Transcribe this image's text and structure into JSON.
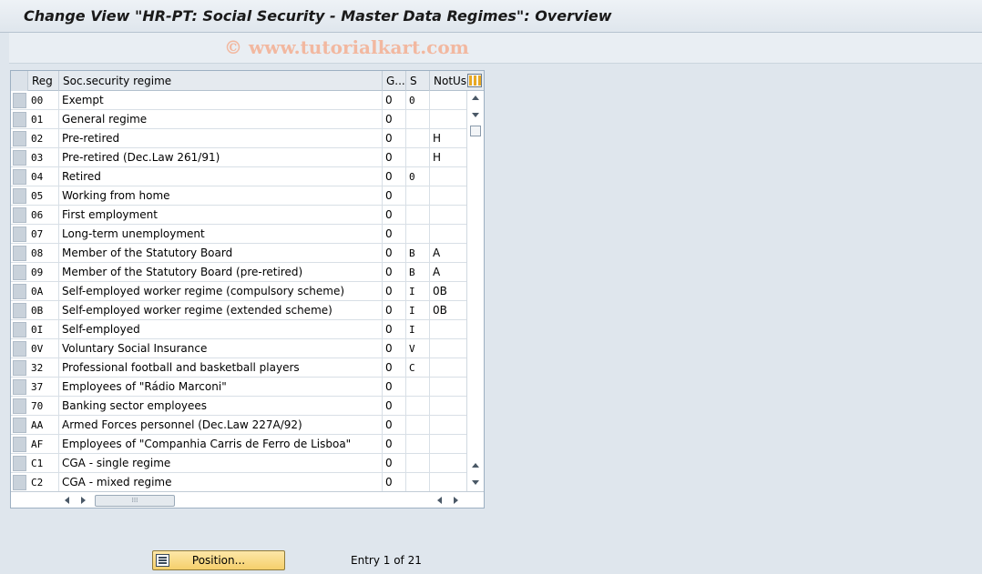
{
  "window": {
    "title": "Change View \"HR-PT: Social Security - Master Data Regimes\": Overview",
    "watermark": "© www.tutorialkart.com"
  },
  "table": {
    "columns": {
      "reg": "Reg",
      "desc": "Soc.security regime",
      "g": "G...",
      "s": "S",
      "notus": "NotUs"
    },
    "rows": [
      {
        "reg": "00",
        "desc": "Exempt",
        "g": "0",
        "s": "0",
        "notus": ""
      },
      {
        "reg": "01",
        "desc": "General regime",
        "g": "0",
        "s": "",
        "notus": ""
      },
      {
        "reg": "02",
        "desc": "Pre-retired",
        "g": "0",
        "s": "",
        "notus": "H"
      },
      {
        "reg": "03",
        "desc": "Pre-retired (Dec.Law 261/91)",
        "g": "0",
        "s": "",
        "notus": "H"
      },
      {
        "reg": "04",
        "desc": "Retired",
        "g": "0",
        "s": "0",
        "notus": ""
      },
      {
        "reg": "05",
        "desc": "Working from home",
        "g": "0",
        "s": "",
        "notus": ""
      },
      {
        "reg": "06",
        "desc": "First employment",
        "g": "0",
        "s": "",
        "notus": ""
      },
      {
        "reg": "07",
        "desc": "Long-term unemployment",
        "g": "0",
        "s": "",
        "notus": ""
      },
      {
        "reg": "08",
        "desc": "Member of the Statutory Board",
        "g": "0",
        "s": "B",
        "notus": "A"
      },
      {
        "reg": "09",
        "desc": "Member of the Statutory Board (pre-retired)",
        "g": "0",
        "s": "B",
        "notus": "A"
      },
      {
        "reg": "0A",
        "desc": "Self-employed worker regime (compulsory scheme)",
        "g": "0",
        "s": "I",
        "notus": "0B"
      },
      {
        "reg": "0B",
        "desc": "Self-employed worker regime (extended scheme)",
        "g": "0",
        "s": "I",
        "notus": "0B"
      },
      {
        "reg": "0I",
        "desc": "Self-employed",
        "g": "0",
        "s": "I",
        "notus": ""
      },
      {
        "reg": "0V",
        "desc": "Voluntary Social Insurance",
        "g": "0",
        "s": "V",
        "notus": ""
      },
      {
        "reg": "32",
        "desc": "Professional football and basketball players",
        "g": "0",
        "s": "C",
        "notus": ""
      },
      {
        "reg": "37",
        "desc": "Employees of \"Rádio Marconi\"",
        "g": "0",
        "s": "",
        "notus": ""
      },
      {
        "reg": "70",
        "desc": "Banking sector employees",
        "g": "0",
        "s": "",
        "notus": ""
      },
      {
        "reg": "AA",
        "desc": "Armed Forces personnel (Dec.Law 227A/92)",
        "g": "0",
        "s": "",
        "notus": ""
      },
      {
        "reg": "AF",
        "desc": "Employees of \"Companhia Carris de Ferro de Lisboa\"",
        "g": "0",
        "s": "",
        "notus": ""
      },
      {
        "reg": "C1",
        "desc": "CGA - single regime",
        "g": "0",
        "s": "",
        "notus": ""
      },
      {
        "reg": "C2",
        "desc": "CGA - mixed regime",
        "g": "0",
        "s": "",
        "notus": ""
      }
    ]
  },
  "footer": {
    "position_button": "Position...",
    "entry_text": "Entry 1 of 21"
  },
  "icons": {
    "column_config": "table-settings-icon",
    "position": "position-icon"
  }
}
